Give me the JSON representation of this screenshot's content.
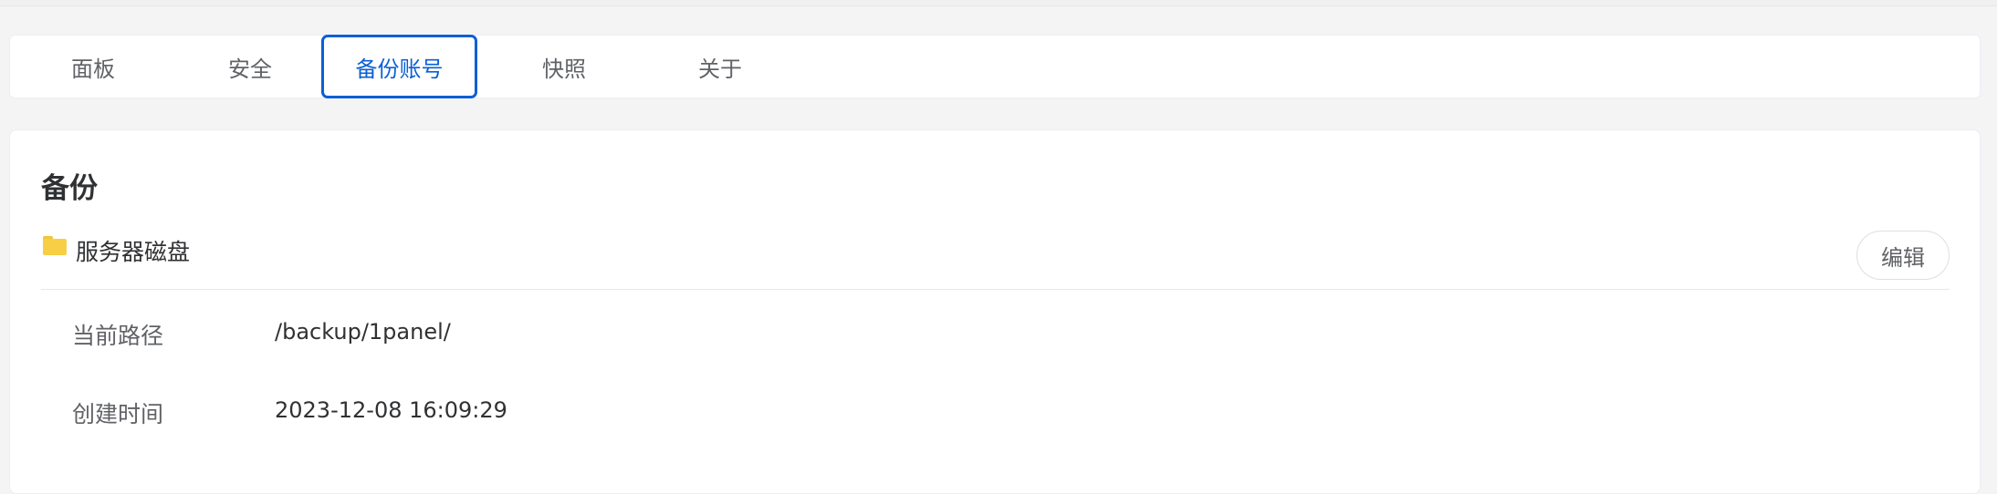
{
  "tabs": [
    {
      "label": "面板",
      "active": false
    },
    {
      "label": "安全",
      "active": false
    },
    {
      "label": "备份账号",
      "active": true
    },
    {
      "label": "快照",
      "active": false
    },
    {
      "label": "关于",
      "active": false
    }
  ],
  "section": {
    "title": "备份",
    "backup_item": {
      "icon": "folder-icon",
      "name": "服务器磁盘",
      "edit_label": "编辑",
      "fields": [
        {
          "label": "当前路径",
          "value": "/backup/1panel/"
        },
        {
          "label": "创建时间",
          "value": "2023-12-08 16:09:29"
        }
      ]
    }
  },
  "colors": {
    "accent": "#0b5fd6",
    "folder": "#f7cf45",
    "background": "#f4f4f5"
  }
}
